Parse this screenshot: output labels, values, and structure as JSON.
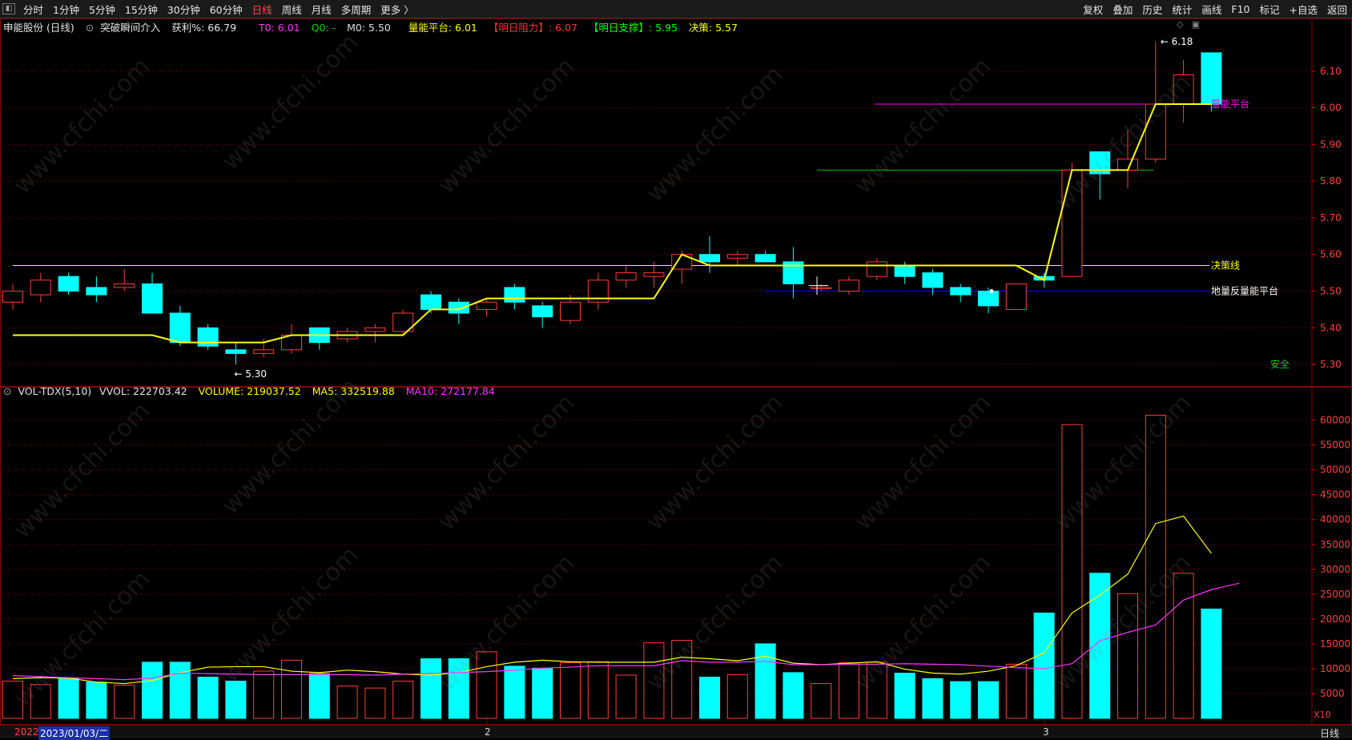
{
  "toolbar": {
    "left": [
      "分时",
      "1分钟",
      "5分钟",
      "15分钟",
      "30分钟",
      "60分钟",
      "日线",
      "周线",
      "月线",
      "多周期",
      "更多 〉"
    ],
    "active": "日线",
    "right": [
      "复权",
      "叠加",
      "历史",
      "统计",
      "画线",
      "F10",
      "标记",
      "+自选",
      "返回"
    ]
  },
  "main_info": {
    "stock": "申能股份 (日线)",
    "indicator": "突破瞬间介入",
    "profit": "获利%: 66.79",
    "t0": "T0: 6.01",
    "q0": "Q0: -",
    "m0": "M0: 5.50",
    "platform": "量能平台: 6.01",
    "resist": "【明日阻力】: 6.07",
    "support": "【明日支撑】: 5.95",
    "decision": "决策: 5.57"
  },
  "vol_info": {
    "name": "VOL-TDX(5,10)",
    "vvol": "VVOL: 222703.42",
    "volume": "VOLUME: 219037.52",
    "ma5": "MA5: 332519.88",
    "ma10": "MA10: 272177.84"
  },
  "labels": {
    "high": "6.18",
    "low": "5.30",
    "platform_line": "量能平台",
    "decision_line": "决策线",
    "low_platform_line": "地量反量能平台",
    "safe": "安全",
    "x10": "X10",
    "period": "日线"
  },
  "bottom": {
    "year_stub": "2022",
    "selected_date": "2023/01/03/二",
    "month2": "2",
    "month3": "3"
  },
  "watermark": "www.cfchi.com",
  "colors": {
    "up": "#ff3c3c",
    "down": "#00ffff",
    "decision": "#ffff00",
    "platform": "#ff00ff",
    "support": "#0000ff",
    "green": "#00c000"
  },
  "chart_data": {
    "type": "candlestick",
    "price_axis": {
      "ylim": [
        5.25,
        6.2
      ],
      "ticks": [
        5.3,
        5.4,
        5.5,
        5.6,
        5.7,
        5.8,
        5.9,
        6.0,
        6.1
      ]
    },
    "volume_axis": {
      "ylim": [
        0,
        63000
      ],
      "ticks": [
        5000,
        10000,
        15000,
        20000,
        25000,
        30000,
        35000,
        40000,
        45000,
        50000,
        55000,
        60000
      ],
      "multiplier": "X10"
    },
    "candles": [
      {
        "o": 5.47,
        "h": 5.52,
        "l": 5.45,
        "c": 5.5,
        "v": 7500
      },
      {
        "o": 5.49,
        "h": 5.55,
        "l": 5.47,
        "c": 5.53,
        "v": 6800
      },
      {
        "o": 5.54,
        "h": 5.55,
        "l": 5.49,
        "c": 5.5,
        "v": 8000
      },
      {
        "o": 5.51,
        "h": 5.54,
        "l": 5.47,
        "c": 5.49,
        "v": 7300
      },
      {
        "o": 5.51,
        "h": 5.56,
        "l": 5.5,
        "c": 5.52,
        "v": 6700
      },
      {
        "o": 5.52,
        "h": 5.55,
        "l": 5.44,
        "c": 5.44,
        "v": 11300
      },
      {
        "o": 5.44,
        "h": 5.46,
        "l": 5.35,
        "c": 5.36,
        "v": 11300
      },
      {
        "o": 5.4,
        "h": 5.41,
        "l": 5.34,
        "c": 5.35,
        "v": 8300
      },
      {
        "o": 5.34,
        "h": 5.36,
        "l": 5.3,
        "c": 5.33,
        "v": 7500
      },
      {
        "o": 5.33,
        "h": 5.37,
        "l": 5.32,
        "c": 5.34,
        "v": 9500
      },
      {
        "o": 5.34,
        "h": 5.41,
        "l": 5.33,
        "c": 5.38,
        "v": 11700
      },
      {
        "o": 5.4,
        "h": 5.4,
        "l": 5.34,
        "c": 5.36,
        "v": 9000
      },
      {
        "o": 5.37,
        "h": 5.4,
        "l": 5.36,
        "c": 5.39,
        "v": 6500
      },
      {
        "o": 5.39,
        "h": 5.41,
        "l": 5.36,
        "c": 5.4,
        "v": 6100
      },
      {
        "o": 5.39,
        "h": 5.45,
        "l": 5.38,
        "c": 5.44,
        "v": 7500
      },
      {
        "o": 5.49,
        "h": 5.5,
        "l": 5.44,
        "c": 5.45,
        "v": 12000
      },
      {
        "o": 5.47,
        "h": 5.48,
        "l": 5.41,
        "c": 5.44,
        "v": 12000
      },
      {
        "o": 5.45,
        "h": 5.48,
        "l": 5.43,
        "c": 5.47,
        "v": 13400
      },
      {
        "o": 5.51,
        "h": 5.52,
        "l": 5.45,
        "c": 5.47,
        "v": 10500
      },
      {
        "o": 5.46,
        "h": 5.47,
        "l": 5.4,
        "c": 5.43,
        "v": 10100
      },
      {
        "o": 5.42,
        "h": 5.49,
        "l": 5.41,
        "c": 5.47,
        "v": 11200
      },
      {
        "o": 5.47,
        "h": 5.55,
        "l": 5.45,
        "c": 5.53,
        "v": 11400
      },
      {
        "o": 5.53,
        "h": 5.57,
        "l": 5.51,
        "c": 5.55,
        "v": 8700
      },
      {
        "o": 5.54,
        "h": 5.58,
        "l": 5.51,
        "c": 5.55,
        "v": 15200
      },
      {
        "o": 5.56,
        "h": 5.61,
        "l": 5.52,
        "c": 5.6,
        "v": 15700
      },
      {
        "o": 5.6,
        "h": 5.65,
        "l": 5.55,
        "c": 5.58,
        "v": 8300
      },
      {
        "o": 5.59,
        "h": 5.61,
        "l": 5.57,
        "c": 5.6,
        "v": 8800
      },
      {
        "o": 5.6,
        "h": 5.61,
        "l": 5.58,
        "c": 5.58,
        "v": 15000
      },
      {
        "o": 5.58,
        "h": 5.62,
        "l": 5.48,
        "c": 5.52,
        "v": 9200
      },
      {
        "o": 5.51,
        "h": 5.52,
        "l": 5.5,
        "c": 5.51,
        "v": 7000
      },
      {
        "o": 5.5,
        "h": 5.54,
        "l": 5.49,
        "c": 5.53,
        "v": 11200
      },
      {
        "o": 5.54,
        "h": 5.59,
        "l": 5.53,
        "c": 5.58,
        "v": 11300
      },
      {
        "o": 5.57,
        "h": 5.58,
        "l": 5.52,
        "c": 5.54,
        "v": 9100
      },
      {
        "o": 5.55,
        "h": 5.56,
        "l": 5.49,
        "c": 5.51,
        "v": 8000
      },
      {
        "o": 5.51,
        "h": 5.52,
        "l": 5.47,
        "c": 5.49,
        "v": 7400
      },
      {
        "o": 5.5,
        "h": 5.51,
        "l": 5.44,
        "c": 5.46,
        "v": 7400
      },
      {
        "o": 5.45,
        "h": 5.52,
        "l": 5.45,
        "c": 5.52,
        "v": 10900
      },
      {
        "o": 5.54,
        "h": 5.55,
        "l": 5.51,
        "c": 5.53,
        "v": 21200
      },
      {
        "o": 5.54,
        "h": 5.85,
        "l": 5.54,
        "c": 5.83,
        "v": 59100
      },
      {
        "o": 5.88,
        "h": 5.88,
        "l": 5.75,
        "c": 5.82,
        "v": 29200
      },
      {
        "o": 5.83,
        "h": 5.94,
        "l": 5.78,
        "c": 5.86,
        "v": 25100
      },
      {
        "o": 5.86,
        "h": 6.18,
        "l": 5.85,
        "c": 6.01,
        "v": 61000
      },
      {
        "o": 6.01,
        "h": 6.13,
        "l": 5.96,
        "c": 6.09,
        "v": 29200
      },
      {
        "o": 6.15,
        "h": 6.15,
        "l": 5.99,
        "c": 6.01,
        "v": 22000
      }
    ],
    "decision_line": [
      5.38,
      5.38,
      5.38,
      5.38,
      5.38,
      5.38,
      5.36,
      5.36,
      5.36,
      5.36,
      5.38,
      5.38,
      5.38,
      5.38,
      5.38,
      5.45,
      5.45,
      5.48,
      5.48,
      5.48,
      5.48,
      5.48,
      5.48,
      5.48,
      5.6,
      5.57,
      5.57,
      5.57,
      5.57,
      5.57,
      5.57,
      5.57,
      5.57,
      5.57,
      5.57,
      5.57,
      5.57,
      5.53,
      5.83,
      5.83,
      5.83,
      6.01,
      6.01,
      6.01
    ],
    "ma5": [
      8000,
      8200,
      8100,
      7300,
      7000,
      7600,
      9200,
      10300,
      10400,
      10400,
      9500,
      9200,
      9700,
      9400,
      8900,
      8700,
      9200,
      10400,
      11300,
      11700,
      11400,
      11300,
      11300,
      11300,
      12300,
      12000,
      11600,
      12500,
      11100,
      10800,
      11100,
      11400,
      9900,
      9100,
      8900,
      9500,
      10600,
      13200,
      21200,
      24800,
      29000,
      39200,
      40700,
      33200
    ],
    "ma10": [
      8600,
      8400,
      8200,
      8000,
      7800,
      8100,
      9100,
      9000,
      8900,
      8800,
      8800,
      8800,
      8800,
      8700,
      8900,
      9000,
      9200,
      9400,
      9700,
      10100,
      10300,
      10600,
      10600,
      10600,
      11600,
      11300,
      11300,
      11500,
      10800,
      10800,
      10900,
      10900,
      11000,
      10900,
      10800,
      10500,
      10200,
      10000,
      11000,
      15600,
      17300,
      18800,
      23800,
      25900,
      27200
    ]
  }
}
